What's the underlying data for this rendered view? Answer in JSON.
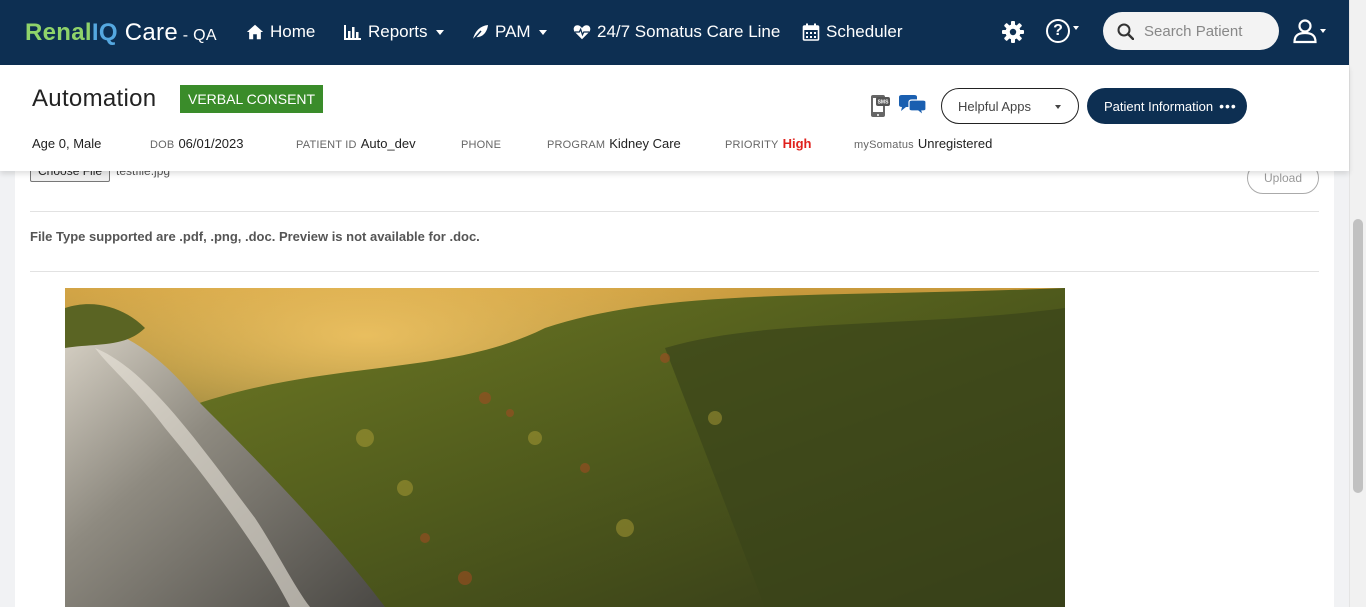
{
  "app": {
    "brand_renal": "Renal",
    "brand_iq": "IQ",
    "brand_care": " Care",
    "brand_env": " - QA"
  },
  "nav": {
    "home": "Home",
    "reports": "Reports",
    "pam": "PAM",
    "care_line": "24/7 Somatus Care Line",
    "scheduler": "Scheduler",
    "search_placeholder": "Search Patient",
    "icons": [
      "home-icon",
      "bar-chart-icon",
      "leaf-icon",
      "heartbeat-icon",
      "calendar-icon",
      "gear-icon",
      "question-circle-icon",
      "search-icon",
      "user-icon"
    ]
  },
  "patient": {
    "name": "Automation",
    "consent_badge": "VERBAL CONSENT",
    "helpful_apps": "Helpful Apps",
    "patient_info": "Patient Information",
    "patient_info_dots": "•••",
    "age_gender": "Age 0, Male",
    "dob_label": "DOB",
    "dob": "06/01/2023",
    "id_label": "PATIENT ID",
    "id": "Auto_dev",
    "phone_label": "PHONE",
    "phone": "",
    "program_label": "PROGRAM",
    "program": "Kidney Care",
    "priority_label": "PRIORITY",
    "priority": "High",
    "mysomatus_label": "mySomatus",
    "mysomatus": "Unregistered",
    "sms_label": "SMS"
  },
  "upload": {
    "choose_file": "Choose File",
    "file_name": "testfile.jpg",
    "upload_button": "Upload",
    "note": "File Type supported are .pdf, .png, .doc. Preview is not available for .doc."
  },
  "colors": {
    "nav_bg": "#0d2f52",
    "brand_green": "#8fd36a",
    "brand_blue": "#55a8e0",
    "consent_green": "#3a8c2a",
    "priority_red": "#e0201c"
  }
}
